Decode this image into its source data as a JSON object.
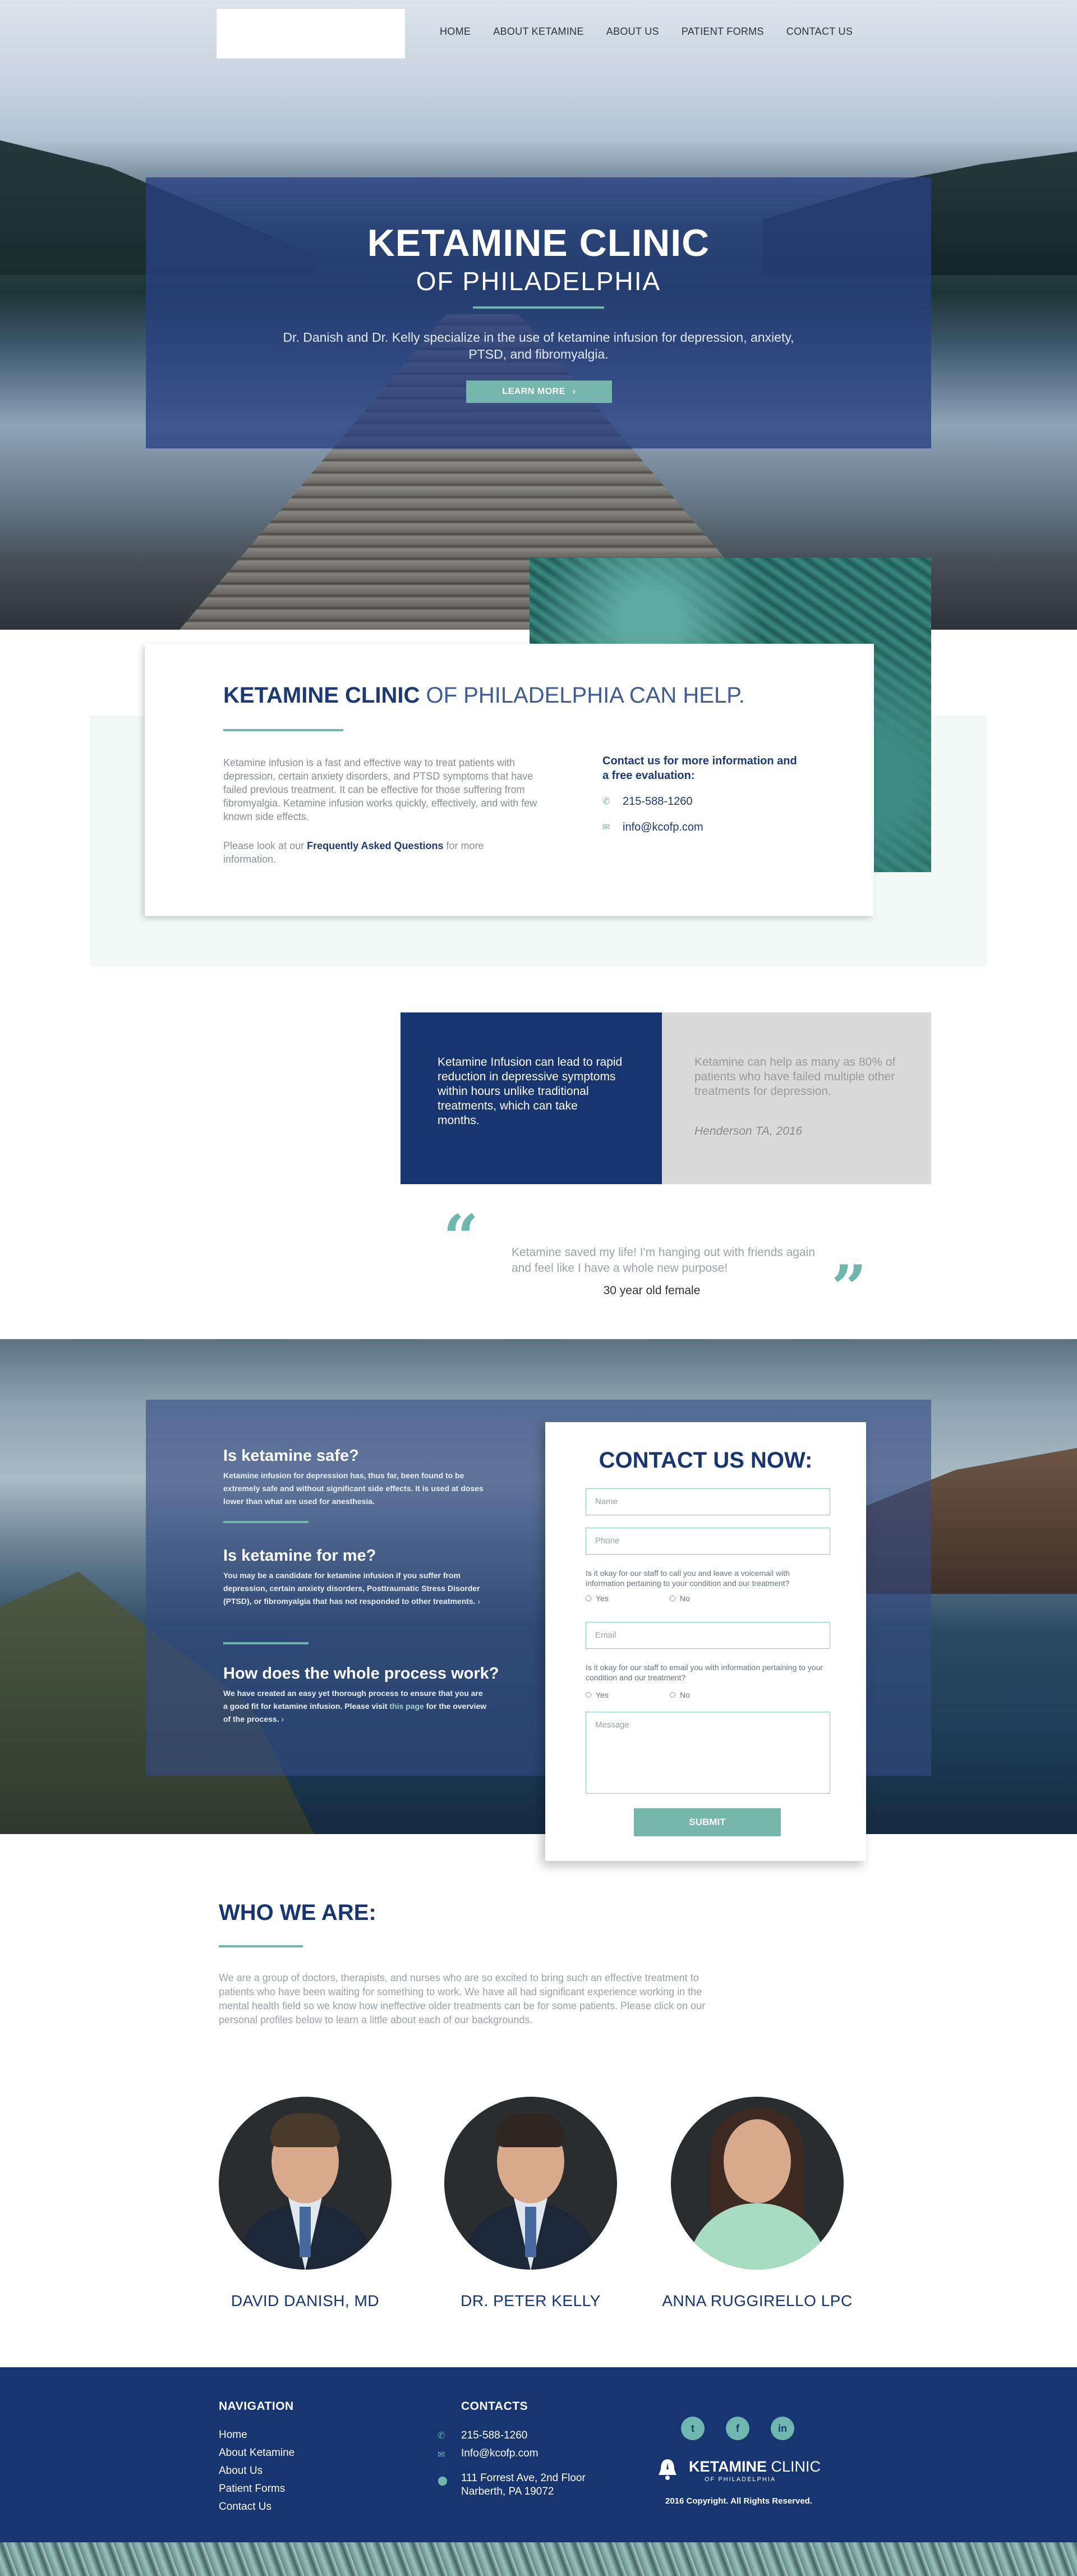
{
  "nav": {
    "items": [
      "HOME",
      "ABOUT KETAMINE",
      "ABOUT US",
      "PATIENT FORMS",
      "CONTACT US"
    ]
  },
  "hero": {
    "title": "KETAMINE CLINIC",
    "subtitle": "OF PHILADELPHIA",
    "description": "Dr. Danish and Dr. Kelly specialize in the use of ketamine infusion for depression, anxiety, PTSD, and fibromyalgia.",
    "button": "LEARN MORE",
    "button_icon": "chevron-right-icon"
  },
  "intro": {
    "title_bold": "KETAMINE CLINIC",
    "title_light": " OF PHILADELPHIA CAN HELP.",
    "body": "Ketamine infusion is a fast and effective way to treat patients with depression, certain anxiety disorders, and PTSD symptoms that have failed previous treatment. It can be effective for those suffering from fibromyalgia. Ketamine infusion works quickly, effectively, and with few known side effects.",
    "faq_prefix": "Please look at our ",
    "faq_link": "Frequently Asked Questions",
    "faq_suffix": " for more information.",
    "contact_title": "Contact us for more information and a free evaluation:",
    "phone": "215-588-1260",
    "email": "info@kcofp.com"
  },
  "stats": {
    "blue_text": "Ketamine Infusion can lead to rapid reduction in depressive symptoms within hours unlike traditional treatments, which can take months.",
    "gray_text": "Ketamine can help as many as 80% of patients who have failed multiple other treatments for depression.",
    "gray_cite": "Henderson TA, 2016"
  },
  "quote": {
    "text": "Ketamine saved my life! I'm hanging out with friends again and feel like I have a whole new purpose!",
    "author": "30 year old female"
  },
  "faq": {
    "q1": "Is ketamine safe?",
    "a1": "Ketamine infusion for depression has, thus far, been found to be extremely safe and without significant side effects. It is used at doses lower than what are used for anesthesia.",
    "q2": "Is ketamine for me?",
    "a2": "You may be a candidate for ketamine infusion if you suffer from depression, certain anxiety disorders, Posttraumatic Stress Disorder (PTSD), or fibromyalgia that has not responded to other treatments.",
    "q3": "How does the whole process work?",
    "a3_prefix": "We have created an easy yet thorough process to ensure that you are a good fit for ketamine infusion. Please visit ",
    "a3_link": "this page",
    "a3_suffix": " for the overview of the process."
  },
  "form": {
    "title": "CONTACT US NOW:",
    "name_placeholder": "Name",
    "phone_placeholder": "Phone",
    "q_call": "Is it okay for our staff to call you and leave a voicemail with information pertaining to your condition and our treatment?",
    "yes": "Yes",
    "no": "No",
    "email_placeholder": "Email",
    "q_email": "Is it okay for our staff to email you with information pertaining to your condition and our treatment?",
    "message_placeholder": "Message",
    "submit": "SUBMIT"
  },
  "who": {
    "title": "WHO WE ARE:",
    "body": "We are a group of doctors, therapists, and nurses who are so excited to bring such an effective treatment to patients who have been waiting for something to work. We have all had significant experience working in the mental health field so we know how ineffective older treatments can be for some patients. Please click on our personal profiles below to learn a little about each of our backgrounds.",
    "people": [
      "DAVID DANISH, MD",
      "DR. PETER KELLY",
      "ANNA RUGGIRELLO LPC"
    ]
  },
  "footer": {
    "nav_title": "NAVIGATION",
    "nav_links": [
      "Home",
      "About Ketamine",
      "About Us",
      "Patient Forms",
      "Contact Us"
    ],
    "contacts_title": "CONTACTS",
    "phone": "215-588-1260",
    "email": "Info@kcofp.com",
    "address1": "111 Forrest Ave, 2nd Floor",
    "address2": "Narberth, PA 19072",
    "social": [
      "twitter-icon",
      "facebook-icon",
      "linkedin-icon"
    ],
    "logo_bold": "KETAMINE",
    "logo_light": " CLINIC",
    "logo_sub": "OF PHILADELPHIA",
    "copyright": "2016 Copyright.  All Rights Reserved."
  },
  "colors": {
    "navy": "#173570",
    "teal": "#6fb6ae",
    "mint": "#f1f8f6",
    "gray_panel": "#dadada"
  }
}
